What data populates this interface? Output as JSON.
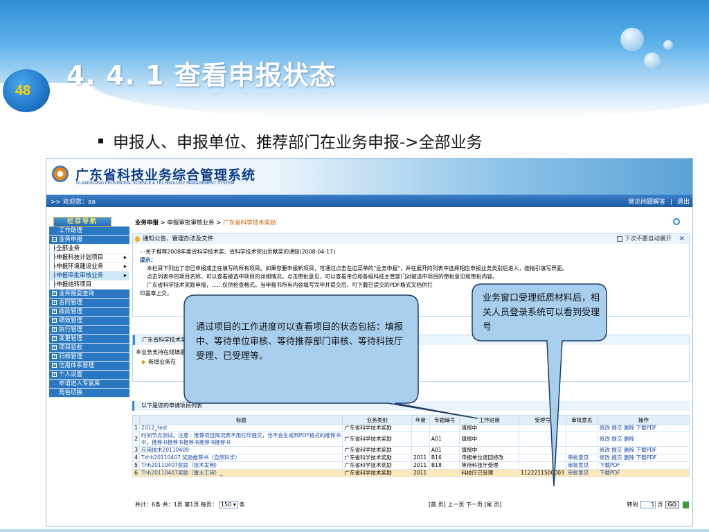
{
  "slide": {
    "page_number": "48",
    "title": "4. 4. 1  查看申报状态",
    "bullet": "申报人、申报单位、推荐部门在业务申报->全部业务"
  },
  "app": {
    "name": "广东省科技业务综合管理系统",
    "subtitle": "GUANGDONG PROVINCEAL SCIENCE & TECHNOLOGY MANAGEMENT SYSTEM",
    "welcome": ">> 欢迎您：aa",
    "top_links": [
      "常见问题解答",
      "|",
      "退出"
    ],
    "nav_title": "栏目导航",
    "nav": [
      {
        "label": "工作助理",
        "type": "item"
      },
      {
        "label": "业务申报",
        "type": "group-open"
      },
      {
        "label": "全部业务",
        "type": "sub"
      },
      {
        "label": "申报科技计划项目",
        "type": "sub-arrow"
      },
      {
        "label": "申报环境建设业务",
        "type": "sub-arrow"
      },
      {
        "label": "申报审批审核业务",
        "type": "sub-arrow-hl"
      },
      {
        "label": "申报结转项目",
        "type": "sub"
      },
      {
        "label": "业务报复查询",
        "type": "group"
      },
      {
        "label": "合同管理",
        "type": "group"
      },
      {
        "label": "拨款管理",
        "type": "group"
      },
      {
        "label": "绩效管理",
        "type": "group"
      },
      {
        "label": "执行管理",
        "type": "group"
      },
      {
        "label": "变更管理",
        "type": "group"
      },
      {
        "label": "项目验收",
        "type": "group"
      },
      {
        "label": "归档管理",
        "type": "group"
      },
      {
        "label": "信用体系管理",
        "type": "group"
      },
      {
        "label": "个人设置",
        "type": "group"
      },
      {
        "label": "申请进入专家库",
        "type": "item"
      },
      {
        "label": "角色切换",
        "type": "item"
      }
    ],
    "breadcrumb": {
      "root": "业务申报",
      "sep1": " > ",
      "mid": "申报审批审核业务",
      "sep2": " > ",
      "current": "广东省科学技术奖励"
    },
    "notice": {
      "head": "通知公告、管理办法及文件",
      "no_popup": "下次不要自动展开",
      "close": "×",
      "line1": "- -关于推荐2008年度省科学技术奖、省科学技术突出贡献奖的通知(2008-04-17)",
      "tip": "提示：",
      "line2": "本栏目下列出了您已申报或正在填写的所有项目。如果您要申报新项目，可通过点击左边菜单的\"业务申报\"，并在展开的列表中选择相应申报业务类别后进入，按指引填写界面。",
      "line3": "点击列表中的项目名称，可以查看被选中项目的详细情况。点击审批意见，可以查看单位和各级科技主管部门对被选中项目的审批意见和审批内容。",
      "line4": "广东省科学技术奖励申报，……仅供检查格式。当申报书所有内容填写完毕并提交后，可下载已提交的PDF格式文档供打",
      "line5": "印盖章上交。"
    },
    "panel2": {
      "head": "广东省科学技术奖励",
      "body": "本业务支持在线填报",
      "new": "新增业务在"
    },
    "list_head": "以下是您的申请项目列表",
    "table": {
      "columns": [
        "",
        "标题",
        "业务类别",
        "年度",
        "专题编号",
        "工作进度",
        "受理号",
        "审批意见",
        "操作"
      ],
      "rows": [
        {
          "idx": "1",
          "title": "2012_test",
          "cat": "广东省科学技术奖励",
          "year": "",
          "code": "",
          "progress": "填报中",
          "acc": "",
          "opinion": "",
          "ops": "修改 提交 删除 下载PDF",
          "sel": false
        },
        {
          "idx": "2",
          "title": "时间节点测试。注意：推荐项目简况表不用打印提交，也不会生成到PDF格式的推荐书中。推荐书推荐书推荐书推荐书推荐书",
          "cat": "广东省科学技术奖励",
          "year": "",
          "code": "A01",
          "progress": "填报中",
          "acc": "",
          "opinion": "",
          "ops": "修改 提交 删除",
          "sel": false
        },
        {
          "idx": "3",
          "title": "应用技术20110409",
          "cat": "广东省科学技术奖励",
          "year": "",
          "code": "A01",
          "progress": "填报中",
          "acc": "",
          "opinion": "",
          "ops": "修改 提交 删除 下载PDF",
          "sel": false
        },
        {
          "idx": "4",
          "title": "Tzhh20110407 奖励推荐书（自然科学）",
          "cat": "广东省科学技术奖励",
          "year": "2011",
          "code": "B16",
          "progress": "申报单位退回修改",
          "acc": "",
          "opinion": "审批意见",
          "ops": "修改 提交 删除 下载PDF",
          "sel": false
        },
        {
          "idx": "5",
          "title": "Thh20110407奖励（技术发明）",
          "cat": "广东省科学技术奖励",
          "year": "2011",
          "code": "B18",
          "progress": "等待科技厅受理",
          "acc": "",
          "opinion": "审批意见",
          "ops": "下载PDF",
          "sel": false
        },
        {
          "idx": "6",
          "title": "Thh20110407奖励（重大工程）_",
          "cat": "广东省科学技术奖励",
          "year": "2011",
          "code": "",
          "progress": "科技厅已受理",
          "acc": "1122211500003",
          "opinion": "审批意见",
          "ops": "下载PDF",
          "sel": true
        }
      ]
    },
    "pager": {
      "summary": "共计：6条 共：1页 第1页 每页：",
      "per_page": "150",
      "unit": "条",
      "nav": "[首 页] 上一页  下一页 [尾 页]",
      "goto": "转到",
      "page_val": "1",
      "page_unit": "页",
      "go": "GO"
    }
  },
  "callouts": {
    "left": "通过项目的工作进度可以查看项目的状态包括：填报中、等待单位审核、等待推荐部门审核、等待科技厅受理、已受理等。",
    "right": "业务窗口受理纸质材料后，相关人员登录系统可以看到受理号"
  },
  "colors": {
    "accent": "#2b78c2",
    "callout_fill": "#a9cfee",
    "title_blue": "#0b3b8a"
  }
}
